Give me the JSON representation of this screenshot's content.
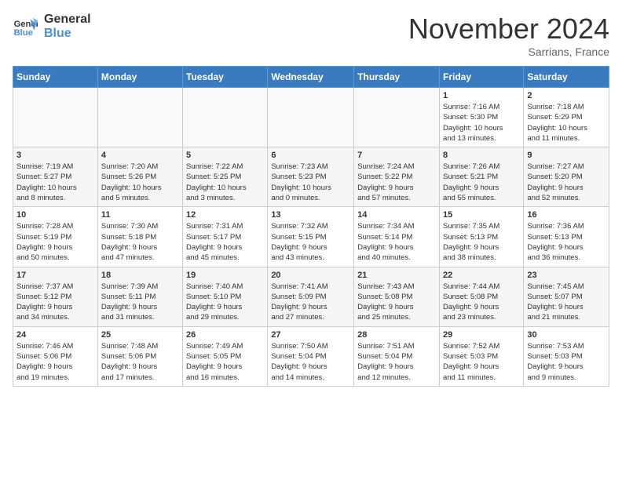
{
  "header": {
    "logo_line1": "General",
    "logo_line2": "Blue",
    "month_title": "November 2024",
    "location": "Sarrians, France"
  },
  "calendar": {
    "headers": [
      "Sunday",
      "Monday",
      "Tuesday",
      "Wednesday",
      "Thursday",
      "Friday",
      "Saturday"
    ],
    "weeks": [
      [
        {
          "day": "",
          "info": ""
        },
        {
          "day": "",
          "info": ""
        },
        {
          "day": "",
          "info": ""
        },
        {
          "day": "",
          "info": ""
        },
        {
          "day": "",
          "info": ""
        },
        {
          "day": "1",
          "info": "Sunrise: 7:16 AM\nSunset: 5:30 PM\nDaylight: 10 hours\nand 13 minutes."
        },
        {
          "day": "2",
          "info": "Sunrise: 7:18 AM\nSunset: 5:29 PM\nDaylight: 10 hours\nand 11 minutes."
        }
      ],
      [
        {
          "day": "3",
          "info": "Sunrise: 7:19 AM\nSunset: 5:27 PM\nDaylight: 10 hours\nand 8 minutes."
        },
        {
          "day": "4",
          "info": "Sunrise: 7:20 AM\nSunset: 5:26 PM\nDaylight: 10 hours\nand 5 minutes."
        },
        {
          "day": "5",
          "info": "Sunrise: 7:22 AM\nSunset: 5:25 PM\nDaylight: 10 hours\nand 3 minutes."
        },
        {
          "day": "6",
          "info": "Sunrise: 7:23 AM\nSunset: 5:23 PM\nDaylight: 10 hours\nand 0 minutes."
        },
        {
          "day": "7",
          "info": "Sunrise: 7:24 AM\nSunset: 5:22 PM\nDaylight: 9 hours\nand 57 minutes."
        },
        {
          "day": "8",
          "info": "Sunrise: 7:26 AM\nSunset: 5:21 PM\nDaylight: 9 hours\nand 55 minutes."
        },
        {
          "day": "9",
          "info": "Sunrise: 7:27 AM\nSunset: 5:20 PM\nDaylight: 9 hours\nand 52 minutes."
        }
      ],
      [
        {
          "day": "10",
          "info": "Sunrise: 7:28 AM\nSunset: 5:19 PM\nDaylight: 9 hours\nand 50 minutes."
        },
        {
          "day": "11",
          "info": "Sunrise: 7:30 AM\nSunset: 5:18 PM\nDaylight: 9 hours\nand 47 minutes."
        },
        {
          "day": "12",
          "info": "Sunrise: 7:31 AM\nSunset: 5:17 PM\nDaylight: 9 hours\nand 45 minutes."
        },
        {
          "day": "13",
          "info": "Sunrise: 7:32 AM\nSunset: 5:15 PM\nDaylight: 9 hours\nand 43 minutes."
        },
        {
          "day": "14",
          "info": "Sunrise: 7:34 AM\nSunset: 5:14 PM\nDaylight: 9 hours\nand 40 minutes."
        },
        {
          "day": "15",
          "info": "Sunrise: 7:35 AM\nSunset: 5:13 PM\nDaylight: 9 hours\nand 38 minutes."
        },
        {
          "day": "16",
          "info": "Sunrise: 7:36 AM\nSunset: 5:13 PM\nDaylight: 9 hours\nand 36 minutes."
        }
      ],
      [
        {
          "day": "17",
          "info": "Sunrise: 7:37 AM\nSunset: 5:12 PM\nDaylight: 9 hours\nand 34 minutes."
        },
        {
          "day": "18",
          "info": "Sunrise: 7:39 AM\nSunset: 5:11 PM\nDaylight: 9 hours\nand 31 minutes."
        },
        {
          "day": "19",
          "info": "Sunrise: 7:40 AM\nSunset: 5:10 PM\nDaylight: 9 hours\nand 29 minutes."
        },
        {
          "day": "20",
          "info": "Sunrise: 7:41 AM\nSunset: 5:09 PM\nDaylight: 9 hours\nand 27 minutes."
        },
        {
          "day": "21",
          "info": "Sunrise: 7:43 AM\nSunset: 5:08 PM\nDaylight: 9 hours\nand 25 minutes."
        },
        {
          "day": "22",
          "info": "Sunrise: 7:44 AM\nSunset: 5:08 PM\nDaylight: 9 hours\nand 23 minutes."
        },
        {
          "day": "23",
          "info": "Sunrise: 7:45 AM\nSunset: 5:07 PM\nDaylight: 9 hours\nand 21 minutes."
        }
      ],
      [
        {
          "day": "24",
          "info": "Sunrise: 7:46 AM\nSunset: 5:06 PM\nDaylight: 9 hours\nand 19 minutes."
        },
        {
          "day": "25",
          "info": "Sunrise: 7:48 AM\nSunset: 5:06 PM\nDaylight: 9 hours\nand 17 minutes."
        },
        {
          "day": "26",
          "info": "Sunrise: 7:49 AM\nSunset: 5:05 PM\nDaylight: 9 hours\nand 16 minutes."
        },
        {
          "day": "27",
          "info": "Sunrise: 7:50 AM\nSunset: 5:04 PM\nDaylight: 9 hours\nand 14 minutes."
        },
        {
          "day": "28",
          "info": "Sunrise: 7:51 AM\nSunset: 5:04 PM\nDaylight: 9 hours\nand 12 minutes."
        },
        {
          "day": "29",
          "info": "Sunrise: 7:52 AM\nSunset: 5:03 PM\nDaylight: 9 hours\nand 11 minutes."
        },
        {
          "day": "30",
          "info": "Sunrise: 7:53 AM\nSunset: 5:03 PM\nDaylight: 9 hours\nand 9 minutes."
        }
      ]
    ]
  }
}
